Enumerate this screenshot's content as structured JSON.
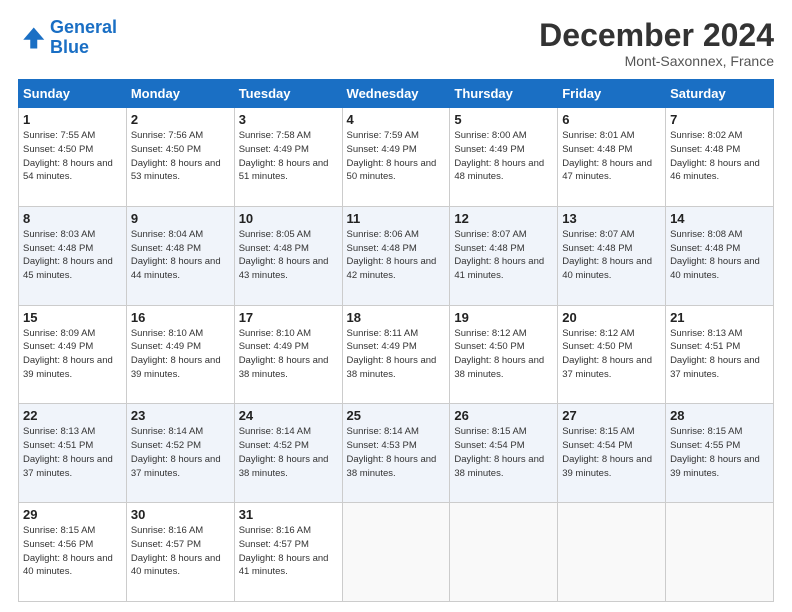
{
  "logo": {
    "line1": "General",
    "line2": "Blue"
  },
  "header": {
    "month": "December 2024",
    "location": "Mont-Saxonnex, France"
  },
  "weekdays": [
    "Sunday",
    "Monday",
    "Tuesday",
    "Wednesday",
    "Thursday",
    "Friday",
    "Saturday"
  ],
  "weeks": [
    [
      {
        "day": "1",
        "sunrise": "7:55 AM",
        "sunset": "4:50 PM",
        "daylight": "8 hours and 54 minutes."
      },
      {
        "day": "2",
        "sunrise": "7:56 AM",
        "sunset": "4:50 PM",
        "daylight": "8 hours and 53 minutes."
      },
      {
        "day": "3",
        "sunrise": "7:58 AM",
        "sunset": "4:49 PM",
        "daylight": "8 hours and 51 minutes."
      },
      {
        "day": "4",
        "sunrise": "7:59 AM",
        "sunset": "4:49 PM",
        "daylight": "8 hours and 50 minutes."
      },
      {
        "day": "5",
        "sunrise": "8:00 AM",
        "sunset": "4:49 PM",
        "daylight": "8 hours and 48 minutes."
      },
      {
        "day": "6",
        "sunrise": "8:01 AM",
        "sunset": "4:48 PM",
        "daylight": "8 hours and 47 minutes."
      },
      {
        "day": "7",
        "sunrise": "8:02 AM",
        "sunset": "4:48 PM",
        "daylight": "8 hours and 46 minutes."
      }
    ],
    [
      {
        "day": "8",
        "sunrise": "8:03 AM",
        "sunset": "4:48 PM",
        "daylight": "8 hours and 45 minutes."
      },
      {
        "day": "9",
        "sunrise": "8:04 AM",
        "sunset": "4:48 PM",
        "daylight": "8 hours and 44 minutes."
      },
      {
        "day": "10",
        "sunrise": "8:05 AM",
        "sunset": "4:48 PM",
        "daylight": "8 hours and 43 minutes."
      },
      {
        "day": "11",
        "sunrise": "8:06 AM",
        "sunset": "4:48 PM",
        "daylight": "8 hours and 42 minutes."
      },
      {
        "day": "12",
        "sunrise": "8:07 AM",
        "sunset": "4:48 PM",
        "daylight": "8 hours and 41 minutes."
      },
      {
        "day": "13",
        "sunrise": "8:07 AM",
        "sunset": "4:48 PM",
        "daylight": "8 hours and 40 minutes."
      },
      {
        "day": "14",
        "sunrise": "8:08 AM",
        "sunset": "4:48 PM",
        "daylight": "8 hours and 40 minutes."
      }
    ],
    [
      {
        "day": "15",
        "sunrise": "8:09 AM",
        "sunset": "4:49 PM",
        "daylight": "8 hours and 39 minutes."
      },
      {
        "day": "16",
        "sunrise": "8:10 AM",
        "sunset": "4:49 PM",
        "daylight": "8 hours and 39 minutes."
      },
      {
        "day": "17",
        "sunrise": "8:10 AM",
        "sunset": "4:49 PM",
        "daylight": "8 hours and 38 minutes."
      },
      {
        "day": "18",
        "sunrise": "8:11 AM",
        "sunset": "4:49 PM",
        "daylight": "8 hours and 38 minutes."
      },
      {
        "day": "19",
        "sunrise": "8:12 AM",
        "sunset": "4:50 PM",
        "daylight": "8 hours and 38 minutes."
      },
      {
        "day": "20",
        "sunrise": "8:12 AM",
        "sunset": "4:50 PM",
        "daylight": "8 hours and 37 minutes."
      },
      {
        "day": "21",
        "sunrise": "8:13 AM",
        "sunset": "4:51 PM",
        "daylight": "8 hours and 37 minutes."
      }
    ],
    [
      {
        "day": "22",
        "sunrise": "8:13 AM",
        "sunset": "4:51 PM",
        "daylight": "8 hours and 37 minutes."
      },
      {
        "day": "23",
        "sunrise": "8:14 AM",
        "sunset": "4:52 PM",
        "daylight": "8 hours and 37 minutes."
      },
      {
        "day": "24",
        "sunrise": "8:14 AM",
        "sunset": "4:52 PM",
        "daylight": "8 hours and 38 minutes."
      },
      {
        "day": "25",
        "sunrise": "8:14 AM",
        "sunset": "4:53 PM",
        "daylight": "8 hours and 38 minutes."
      },
      {
        "day": "26",
        "sunrise": "8:15 AM",
        "sunset": "4:54 PM",
        "daylight": "8 hours and 38 minutes."
      },
      {
        "day": "27",
        "sunrise": "8:15 AM",
        "sunset": "4:54 PM",
        "daylight": "8 hours and 39 minutes."
      },
      {
        "day": "28",
        "sunrise": "8:15 AM",
        "sunset": "4:55 PM",
        "daylight": "8 hours and 39 minutes."
      }
    ],
    [
      {
        "day": "29",
        "sunrise": "8:15 AM",
        "sunset": "4:56 PM",
        "daylight": "8 hours and 40 minutes."
      },
      {
        "day": "30",
        "sunrise": "8:16 AM",
        "sunset": "4:57 PM",
        "daylight": "8 hours and 40 minutes."
      },
      {
        "day": "31",
        "sunrise": "8:16 AM",
        "sunset": "4:57 PM",
        "daylight": "8 hours and 41 minutes."
      },
      null,
      null,
      null,
      null
    ]
  ]
}
